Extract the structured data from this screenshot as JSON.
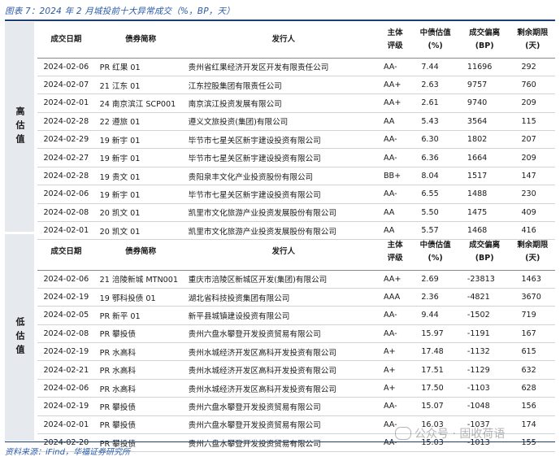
{
  "title": "图表 7：2024 年 2 月城投前十大异常成交（%，BP，天）",
  "source": "资料来源：iFind，华福证券研究所",
  "headers": {
    "date": "成交日期",
    "bond": "债券简称",
    "issuer": "发行人",
    "rating_1": "主体",
    "rating_2": "评级",
    "val_1": "中债估值",
    "val_2": "(%)",
    "dev_1": "成交偏离",
    "dev_2": "(BP)",
    "rem_1": "剩余期限",
    "rem_2": "(天)"
  },
  "high": {
    "label": "高估值",
    "rows": [
      {
        "date": "2024-02-06",
        "bond": "PR 红果 01",
        "issuer": "贵州省红果经济开发区开发有限责任公司",
        "rating": "AA-",
        "val": "7.44",
        "dev": "11696",
        "rem": "292"
      },
      {
        "date": "2024-02-07",
        "bond": "21 江东 01",
        "issuer": "江东控股集团有限责任公司",
        "rating": "AA+",
        "val": "2.63",
        "dev": "9757",
        "rem": "760"
      },
      {
        "date": "2024-02-01",
        "bond": "24 南京滨江 SCP001",
        "issuer": "南京滨江投资发展有限公司",
        "rating": "AA+",
        "val": "2.61",
        "dev": "9740",
        "rem": "209"
      },
      {
        "date": "2024-02-28",
        "bond": "22 遵旅 01",
        "issuer": "遵义文旅投资(集团)有限公司",
        "rating": "AA",
        "val": "5.43",
        "dev": "3564",
        "rem": "115"
      },
      {
        "date": "2024-02-29",
        "bond": "19 新宇 01",
        "issuer": "毕节市七星关区新宇建设投资有限公司",
        "rating": "AA-",
        "val": "6.30",
        "dev": "1802",
        "rem": "207"
      },
      {
        "date": "2024-02-27",
        "bond": "19 新宇 01",
        "issuer": "毕节市七星关区新宇建设投资有限公司",
        "rating": "AA-",
        "val": "6.36",
        "dev": "1664",
        "rem": "209"
      },
      {
        "date": "2024-02-28",
        "bond": "19 贵文 01",
        "issuer": "贵阳泉丰文化产业投资股份有限公司",
        "rating": "BB+",
        "val": "8.04",
        "dev": "1517",
        "rem": "147"
      },
      {
        "date": "2024-02-06",
        "bond": "19 新宇 01",
        "issuer": "毕节市七星关区新宇建设投资有限公司",
        "rating": "AA-",
        "val": "6.55",
        "dev": "1488",
        "rem": "230"
      },
      {
        "date": "2024-02-08",
        "bond": "20 凯文 01",
        "issuer": "凯里市文化旅游产业投资发展股份有限公司",
        "rating": "AA",
        "val": "5.50",
        "dev": "1475",
        "rem": "409"
      },
      {
        "date": "2024-02-01",
        "bond": "20 凯文 01",
        "issuer": "凯里市文化旅游产业投资发展股份有限公司",
        "rating": "AA",
        "val": "5.57",
        "dev": "1468",
        "rem": "416"
      }
    ]
  },
  "low": {
    "label": "低估值",
    "rows": [
      {
        "date": "2024-02-06",
        "bond": "21 涪陵新城 MTN001",
        "issuer": "重庆市涪陵区新城区开发(集团)有限公司",
        "rating": "AA+",
        "val": "2.69",
        "dev": "-23813",
        "rem": "1463"
      },
      {
        "date": "2024-02-19",
        "bond": "19 鄂科投债 01",
        "issuer": "湖北省科技投资集团有限公司",
        "rating": "AAA",
        "val": "2.36",
        "dev": "-4821",
        "rem": "3670"
      },
      {
        "date": "2024-02-05",
        "bond": "PR 新平 01",
        "issuer": "新平县城镇建设投资有限公司",
        "rating": "AA-",
        "val": "9.44",
        "dev": "-1502",
        "rem": "719"
      },
      {
        "date": "2024-02-08",
        "bond": "PR 攀投债",
        "issuer": "贵州六盘水攀登开发投资贸易有限公司",
        "rating": "AA-",
        "val": "15.97",
        "dev": "-1191",
        "rem": "167"
      },
      {
        "date": "2024-02-19",
        "bond": "PR 水高科",
        "issuer": "贵州水城经济开发区高科开发投资有限公司",
        "rating": "A+",
        "val": "17.48",
        "dev": "-1132",
        "rem": "615"
      },
      {
        "date": "2024-02-21",
        "bond": "PR 水高科",
        "issuer": "贵州水城经济开发区高科开发投资有限公司",
        "rating": "A+",
        "val": "17.51",
        "dev": "-1129",
        "rem": "632"
      },
      {
        "date": "2024-02-06",
        "bond": "PR 水高科",
        "issuer": "贵州水城经济开发区高科开发投资有限公司",
        "rating": "A+",
        "val": "17.50",
        "dev": "-1103",
        "rem": "628"
      },
      {
        "date": "2024-02-19",
        "bond": "PR 攀投债",
        "issuer": "贵州六盘水攀登开发投资贸易有限公司",
        "rating": "AA-",
        "val": "15.07",
        "dev": "-1048",
        "rem": "156"
      },
      {
        "date": "2024-02-01",
        "bond": "PR 攀投债",
        "issuer": "贵州六盘水攀登开发投资贸易有限公司",
        "rating": "AA-",
        "val": "16.03",
        "dev": "-1037",
        "rem": "174"
      },
      {
        "date": "2024-02-20",
        "bond": "PR 攀投债",
        "issuer": "贵州六盘水攀登开发投资贸易有限公司",
        "rating": "AA-",
        "val": "15.03",
        "dev": "-1013",
        "rem": "155"
      }
    ]
  },
  "watermark": "公众号 · 固收荷语",
  "colors": {
    "accent": "#2a5aa8",
    "rule": "#1c3d7a",
    "sidebar": "#e6e9ee"
  }
}
